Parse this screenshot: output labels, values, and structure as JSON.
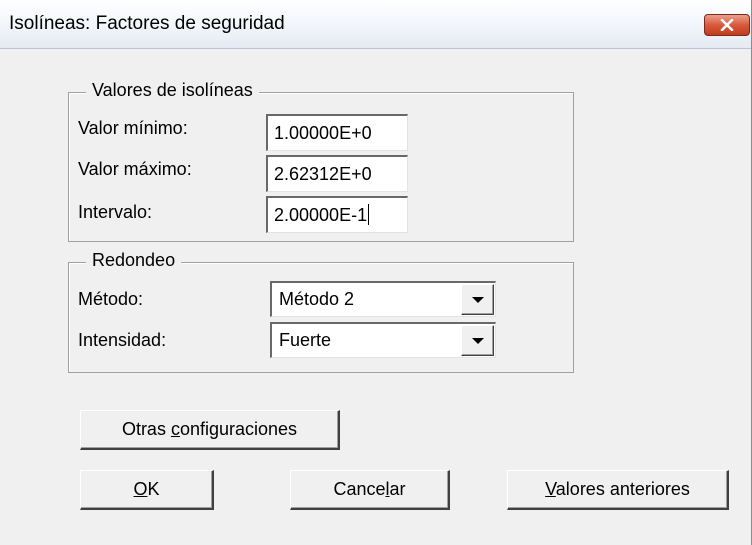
{
  "window": {
    "title": "Isolíneas:  Factores de seguridad",
    "close_icon": "close-icon"
  },
  "isolines_group": {
    "legend": "Valores de isolíneas",
    "min_label": "Valor mínimo:",
    "min_value": "1.00000E+0",
    "max_label": "Valor máximo:",
    "max_value": "2.62312E+0",
    "interval_label": "Intervalo:",
    "interval_value": "2.00000E-1"
  },
  "rounding_group": {
    "legend": "Redondeo",
    "method_label": "Método:",
    "method_value": "Método 2",
    "intensity_label": "Intensidad:",
    "intensity_value": "Fuerte"
  },
  "buttons": {
    "other_settings_pre": "Otras ",
    "other_settings_key": "c",
    "other_settings_post": "onfiguraciones",
    "ok_key": "O",
    "ok_post": "K",
    "cancel_pre": "Cance",
    "cancel_key": "l",
    "cancel_post": "ar",
    "previous_key": "V",
    "previous_post": "alores anteriores"
  }
}
